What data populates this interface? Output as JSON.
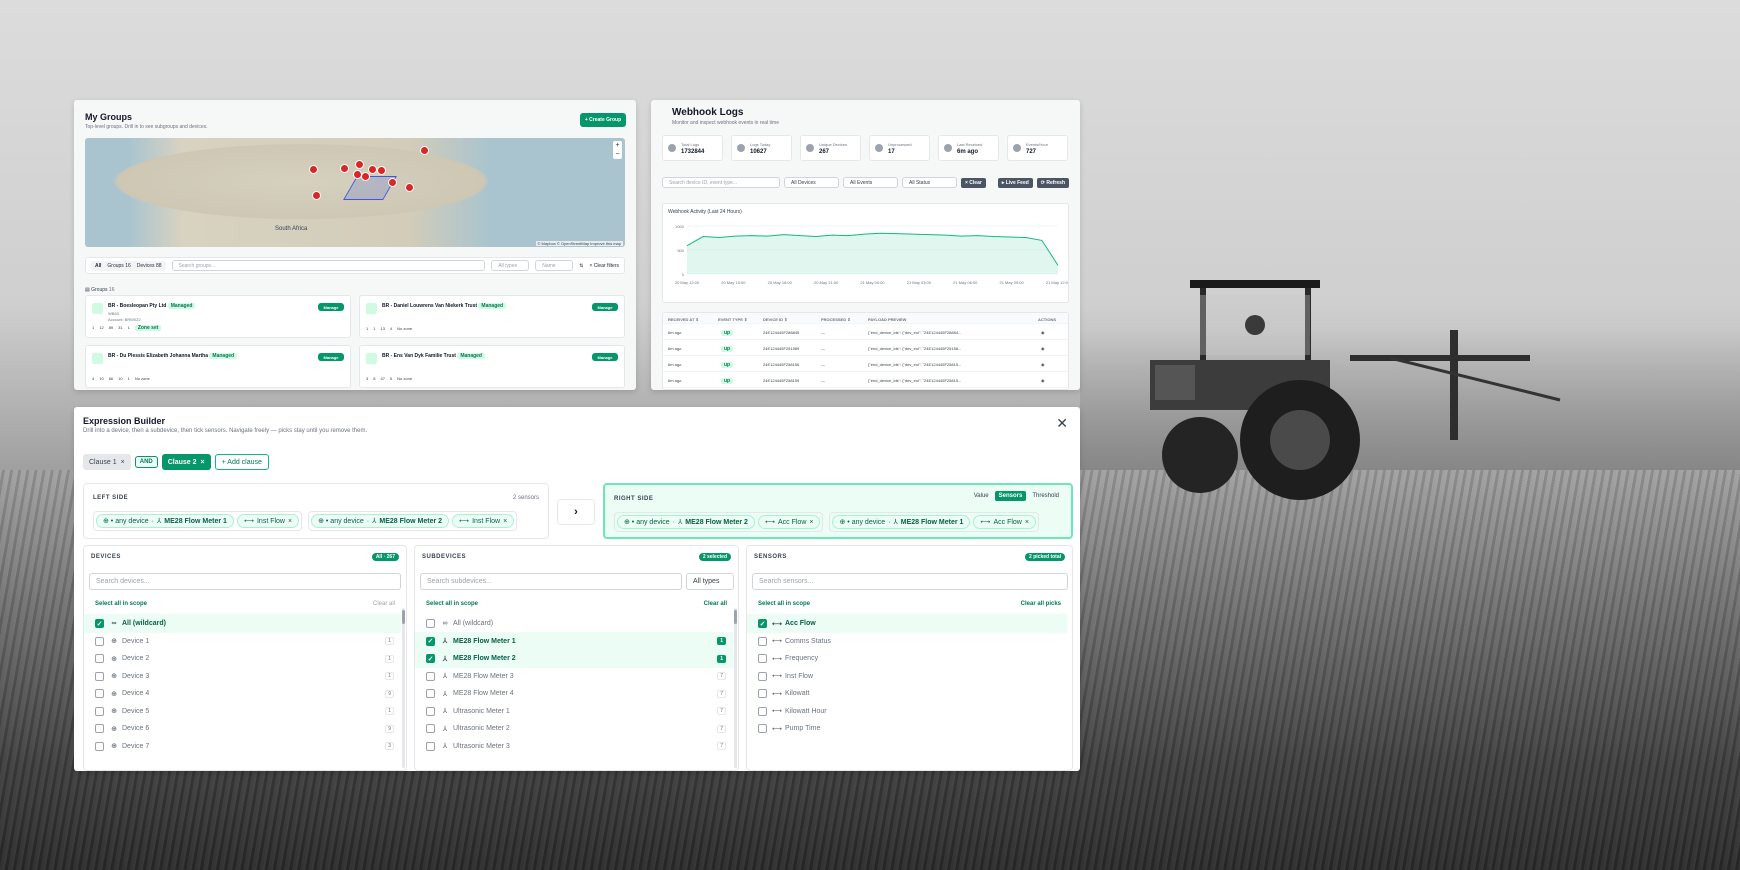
{
  "groups": {
    "title": "My Groups",
    "subtitle": "Top-level groups. Drill in to see subgroups and devices.",
    "create_label": "+ Create Group",
    "map_label": "South Africa",
    "map_attribution": "© Mapbox © OpenStreetMap Improve this map",
    "filter_tabs": [
      "All",
      "Groups",
      "Devices"
    ],
    "filter_counts": [
      "",
      "16",
      "88"
    ],
    "search_placeholder": "Search groups...",
    "type_select": "All types",
    "sort_select": "Name",
    "clear_filters": "× Clear filters",
    "section_label": "Groups",
    "section_count": "16",
    "cards": [
      {
        "name": "BR - Boesleopan Pty Ltd",
        "badge": "Managed",
        "extra1": "WB63",
        "extra2": "Account: BRW022",
        "stats": [
          "1",
          "12",
          "89",
          "31",
          "1"
        ],
        "zone": "Zone set",
        "manage": "Manage"
      },
      {
        "name": "BR - Daniel Louwrens Van Niekerk Trust",
        "badge": "Managed",
        "extra1": "",
        "extra2": "",
        "stats": [
          "1",
          "1",
          "13",
          "4"
        ],
        "zone": "No zone",
        "manage": "Manage"
      },
      {
        "name": "BR - Du Plessis Elizabeth Johanna Martha",
        "badge": "Managed",
        "extra1": "",
        "extra2": "",
        "stats": [
          "4",
          "10",
          "66",
          "10",
          "1"
        ],
        "zone": "No zone",
        "manage": "Manage"
      },
      {
        "name": "BR - Ens Van Dyk Familie Trust",
        "badge": "Managed",
        "extra1": "",
        "extra2": "",
        "stats": [
          "3",
          "8",
          "47",
          "5"
        ],
        "zone": "No zone",
        "manage": "Manage"
      }
    ]
  },
  "webhook": {
    "title": "Webhook Logs",
    "subtitle": "Monitor and inspect webhook events in real time",
    "stats": [
      {
        "label": "Total Logs",
        "value": "1732844"
      },
      {
        "label": "Logs Today",
        "value": "10627"
      },
      {
        "label": "Unique Devices",
        "value": "267"
      },
      {
        "label": "Unprocessed",
        "value": "17"
      },
      {
        "label": "Last Received",
        "value": "6m ago"
      },
      {
        "label": "Events/Hour",
        "value": "727"
      }
    ],
    "search_placeholder": "Search device ID, event type...",
    "device_select": "All Devices",
    "event_select": "All Events",
    "status_select": "All Status",
    "clear_label": "× Clear",
    "live_label": "▸ Live Feed",
    "refresh_label": "⟳ Refresh",
    "chart_title": "Webhook Activity (Last 24 Hours)",
    "columns": [
      "RECEIVED AT ⇕",
      "EVENT TYPE ⇕",
      "DEVICE ID ⇕",
      "PROCESSED ⇕",
      "PAYLOAD PREVIEW",
      "ACTIONS"
    ],
    "rows": [
      {
        "received": "6m ago",
        "type": "up",
        "device": "24E124445F288845",
        "processed": "—",
        "payload": "{\"end_device_ids\": {\"dev_eui\": \"24E124445F28884..."
      },
      {
        "received": "6m ago",
        "type": "up",
        "device": "24E124445F251589",
        "processed": "—",
        "payload": "{\"end_device_ids\": {\"dev_eui\": \"24E124445F25158..."
      },
      {
        "received": "6m ago",
        "type": "up",
        "device": "24E124445F258156",
        "processed": "—",
        "payload": "{\"end_device_ids\": {\"dev_eui\": \"24E124445F25815..."
      },
      {
        "received": "6m ago",
        "type": "up",
        "device": "24E124445F258159",
        "processed": "—",
        "payload": "{\"end_device_ids\": {\"dev_eui\": \"24E124445F25815..."
      }
    ]
  },
  "chart_data": {
    "type": "area",
    "title": "Webhook Activity (Last 24 Hours)",
    "x": [
      "20 May 12:00",
      "20 May 15:00",
      "20 May 18:00",
      "20 May 21:00",
      "21 May 00:00",
      "21 May 03:00",
      "21 May 06:00",
      "21 May 09:00",
      "21 May 12:00"
    ],
    "series": [
      {
        "values": [
          590,
          780,
          760,
          790,
          800,
          790,
          820,
          800,
          780,
          810,
          800,
          830,
          850,
          840,
          830,
          820,
          810,
          790,
          800,
          780,
          770,
          760,
          700,
          180
        ]
      }
    ],
    "ylim": [
      0,
      1000
    ],
    "yticks": [
      "0",
      "500",
      "1000"
    ],
    "grid": true
  },
  "expr": {
    "title": "Expression Builder",
    "subtitle": "Drill into a device, then a subdevice, then tick sensors. Navigate freely — picks stay until you remove them.",
    "clauses": [
      "Clause 1",
      "AND",
      "Clause 2",
      "+ Add clause"
    ],
    "left": {
      "label": "LEFT SIDE",
      "count": "2 sensors",
      "groups": [
        {
          "device": "⊕ • any device",
          "sub": "ME28 Flow Meter 1",
          "sensor": "Inst Flow"
        },
        {
          "device": "⊕ • any device",
          "sub": "ME28 Flow Meter 2",
          "sensor": "Inst Flow"
        }
      ]
    },
    "right": {
      "label": "RIGHT SIDE",
      "toggle": [
        "Value",
        "Sensors",
        "Threshold"
      ],
      "groups": [
        {
          "device": "⊕ • any device",
          "sub": "ME28 Flow Meter 2",
          "sensor": "Acc Flow"
        },
        {
          "device": "⊕ • any device",
          "sub": "ME28 Flow Meter 1",
          "sensor": "Acc Flow"
        }
      ]
    },
    "devices": {
      "label": "DEVICES",
      "badge": "All · 267",
      "search": "Search devices...",
      "scope": "Select all in scope",
      "clear": "Clear all",
      "items": [
        {
          "label": "All (wildcard)",
          "count": "",
          "selected": true,
          "icon": "∞"
        },
        {
          "label": "Device 1",
          "count": "1",
          "selected": false,
          "icon": "⊕"
        },
        {
          "label": "Device 2",
          "count": "1",
          "selected": false,
          "icon": "⊕"
        },
        {
          "label": "Device 3",
          "count": "1",
          "selected": false,
          "icon": "⊕"
        },
        {
          "label": "Device 4",
          "count": "9",
          "selected": false,
          "icon": "⊕"
        },
        {
          "label": "Device 5",
          "count": "1",
          "selected": false,
          "icon": "⊕"
        },
        {
          "label": "Device 6",
          "count": "9",
          "selected": false,
          "icon": "⊕"
        },
        {
          "label": "Device 7",
          "count": "3",
          "selected": false,
          "icon": "⊕"
        }
      ]
    },
    "subdevices": {
      "label": "SUBDEVICES",
      "badge": "2 selected",
      "search": "Search subdevices...",
      "type_select": "All types",
      "scope": "Select all in scope",
      "clear": "Clear all",
      "items": [
        {
          "label": "All (wildcard)",
          "count": "",
          "selected": false,
          "icon": "∞"
        },
        {
          "label": "ME28 Flow Meter 1",
          "count": "1",
          "selected": true,
          "icon": "⅄"
        },
        {
          "label": "ME28 Flow Meter 2",
          "count": "1",
          "selected": true,
          "icon": "⅄"
        },
        {
          "label": "ME28 Flow Meter 3",
          "count": "7",
          "selected": false,
          "icon": "⅄"
        },
        {
          "label": "ME28 Flow Meter 4",
          "count": "7",
          "selected": false,
          "icon": "⅄"
        },
        {
          "label": "Ultrasonic Meter 1",
          "count": "7",
          "selected": false,
          "icon": "⅄"
        },
        {
          "label": "Ultrasonic Meter 2",
          "count": "7",
          "selected": false,
          "icon": "⅄"
        },
        {
          "label": "Ultrasonic Meter 3",
          "count": "7",
          "selected": false,
          "icon": "⅄"
        }
      ]
    },
    "sensors": {
      "label": "SENSORS",
      "badge": "2 picked total",
      "search": "Search sensors...",
      "scope": "Select all in scope",
      "clear": "Clear all picks",
      "items": [
        {
          "label": "Acc Flow",
          "selected": true,
          "icon": "⟷"
        },
        {
          "label": "Comms Status",
          "selected": false,
          "icon": "⟷"
        },
        {
          "label": "Frequency",
          "selected": false,
          "icon": "⟷"
        },
        {
          "label": "Inst Flow",
          "selected": false,
          "icon": "⟷"
        },
        {
          "label": "Kilowatt",
          "selected": false,
          "icon": "⟷"
        },
        {
          "label": "Kilowatt Hour",
          "selected": false,
          "icon": "⟷"
        },
        {
          "label": "Pump Time",
          "selected": false,
          "icon": "⟷"
        }
      ]
    }
  }
}
